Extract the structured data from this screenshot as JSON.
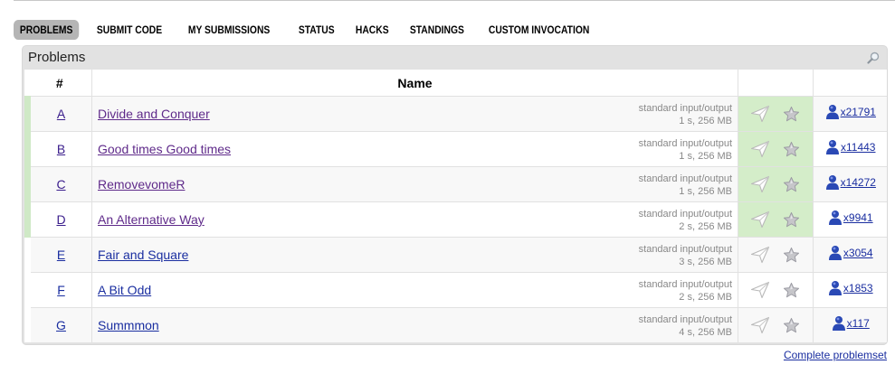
{
  "menu": [
    {
      "label": "PROBLEMS",
      "active": true
    },
    {
      "label": "SUBMIT CODE",
      "active": false
    },
    {
      "label": "MY SUBMISSIONS",
      "active": false
    },
    {
      "label": "STATUS",
      "active": false
    },
    {
      "label": "HACKS",
      "active": false
    },
    {
      "label": "STANDINGS",
      "active": false
    },
    {
      "label": "CUSTOM INVOCATION",
      "active": false
    }
  ],
  "box": {
    "title": "Problems",
    "search_icon": "magnifier-icon"
  },
  "table": {
    "headers": {
      "index": "#",
      "name": "Name"
    },
    "problems": [
      {
        "index": "A",
        "name": "Divide and Conquer",
        "io": "standard input/output",
        "limits": "1 s, 256 MB",
        "solved_count": "x21791",
        "accepted": true
      },
      {
        "index": "B",
        "name": "Good times Good times",
        "io": "standard input/output",
        "limits": "1 s, 256 MB",
        "solved_count": "x11443",
        "accepted": true
      },
      {
        "index": "C",
        "name": "RemovevomeR",
        "io": "standard input/output",
        "limits": "1 s, 256 MB",
        "solved_count": "x14272",
        "accepted": true
      },
      {
        "index": "D",
        "name": "An Alternative Way",
        "io": "standard input/output",
        "limits": "2 s, 256 MB",
        "solved_count": "x9941",
        "accepted": true
      },
      {
        "index": "E",
        "name": "Fair and Square",
        "io": "standard input/output",
        "limits": "3 s, 256 MB",
        "solved_count": "x3054",
        "accepted": false
      },
      {
        "index": "F",
        "name": "A Bit Odd",
        "io": "standard input/output",
        "limits": "2 s, 256 MB",
        "solved_count": "x1853",
        "accepted": false
      },
      {
        "index": "G",
        "name": "Summmon",
        "io": "standard input/output",
        "limits": "4 s, 256 MB",
        "solved_count": "x117",
        "accepted": false
      }
    ]
  },
  "footer": {
    "complete_link": "Complete problemset"
  },
  "colors": {
    "accepted_bg": "#d4edc9",
    "accepted_stripe": "#cfe9c6",
    "link": "#1a2ea0",
    "visited_link": "#5f2a8a"
  }
}
